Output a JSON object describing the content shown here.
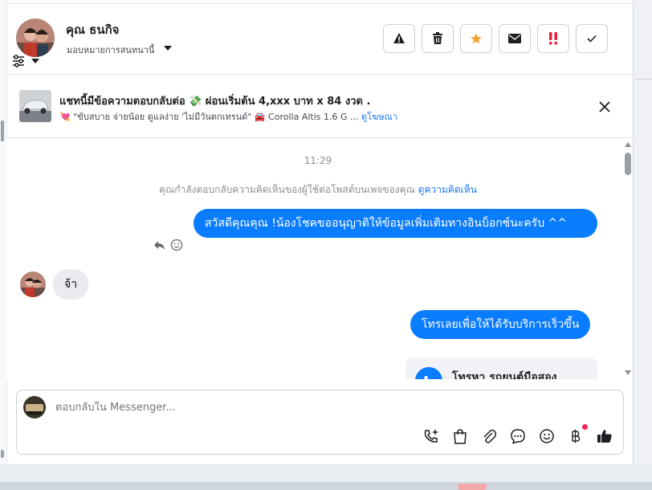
{
  "header": {
    "name": "คุณ ธนกิจ",
    "assign_label": "มอบหมายการสนทนานี้",
    "actions": [
      {
        "name": "report-button",
        "icon": "warning-icon"
      },
      {
        "name": "delete-button",
        "icon": "trash-icon"
      },
      {
        "name": "star-button",
        "icon": "star-icon"
      },
      {
        "name": "mark-unread-button",
        "icon": "envelope-icon"
      },
      {
        "name": "important-button",
        "icon": "exclamation-icon"
      },
      {
        "name": "done-button",
        "icon": "checkmark-icon"
      }
    ],
    "colors": {
      "star": "#f7a234",
      "important": "#e41e3f"
    }
  },
  "ad": {
    "title": "แชทนี้มีข้อความตอบกลับต่อ 💸 ผ่อนเริ่มต้น 4,xxx บาท x 84 งวด .",
    "subtitle": "💘 \"ขับสบาย จ่ายน้อย ดูแลง่าย 'ไม่มีวันตกเทรนด์\" 🚘 Corolla Altis 1.6 G ...",
    "link": "ดูโฆษณา"
  },
  "chat": {
    "time": "11:29",
    "notice": "คุณกำลังตอบกลับความคิดเห็นของผู้ใช้ต่อโพสต์บนเพจของคุณ",
    "notice_link": "ดูความคิดเห็น",
    "messages": [
      {
        "direction": "outgoing",
        "text": "สวัสดีคุณคุณ !น้องโชคขออนุญาติให้ข้อมูลเพิ่มเติมทางอินบ็อกซ์นะครับ ^^"
      },
      {
        "direction": "incoming",
        "text": "จ้า"
      },
      {
        "direction": "outgoing",
        "text": "โทรเลยเพื่อให้ได้รับบริการเร็วขึ้น"
      }
    ],
    "card_title": "โทรหา รถยนต์มือสอง"
  },
  "composer": {
    "placeholder": "ตอบกลับใน Messenger...",
    "tools": [
      "call-add-icon",
      "bag-icon",
      "paperclip-icon",
      "chat-bubble-icon",
      "emoji-icon",
      "baht-icon",
      "thumbs-up-icon"
    ],
    "accent": "#0a7cff"
  }
}
